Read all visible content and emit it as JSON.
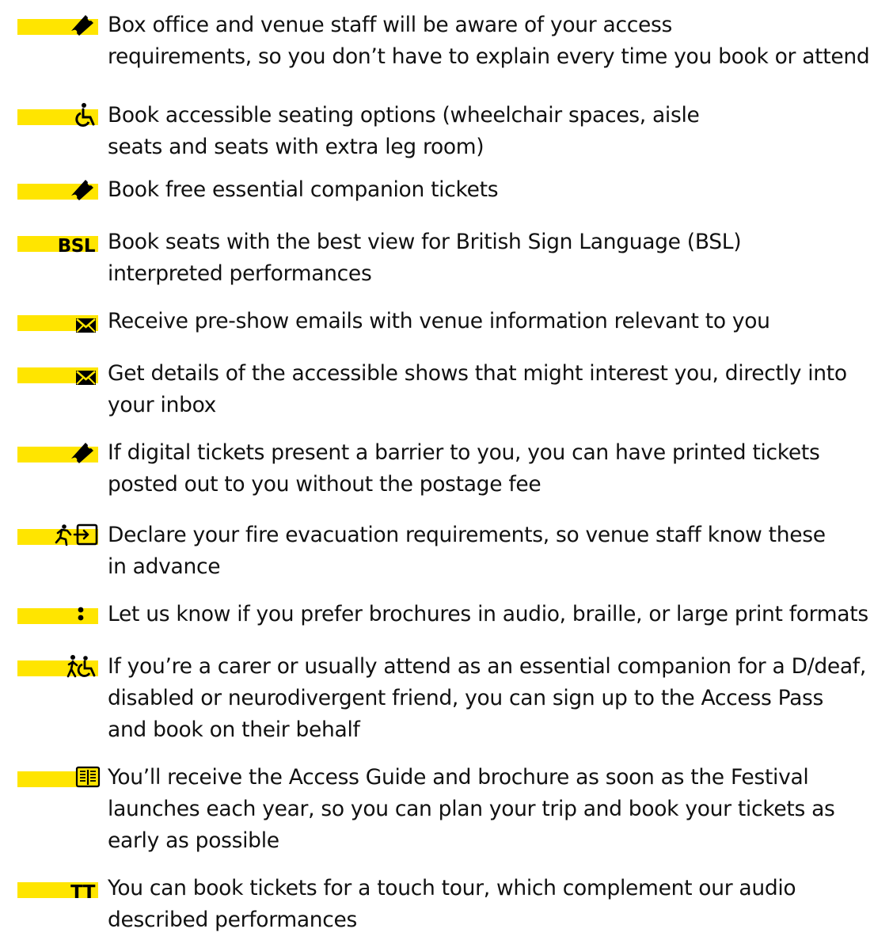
{
  "colors": {
    "badge": "#ffe500",
    "text": "#111111"
  },
  "items": [
    {
      "icon": "ticket-icon",
      "text": "Box office and venue staff will be aware of your access\nrequirements, so you don’t have to explain every time you book or attend"
    },
    {
      "icon": "wheelchair-icon",
      "text": "Book accessible seating options (wheelchair spaces, aisle\nseats and seats with extra leg room)"
    },
    {
      "icon": "ticket-icon",
      "text": "Book free essential companion tickets"
    },
    {
      "icon": "bsl-icon",
      "icon_text": "BSL",
      "text": "Book seats with the best view for British Sign Language (BSL)\ninterpreted performances"
    },
    {
      "icon": "envelope-icon",
      "text": "Receive pre-show emails with venue information relevant to you"
    },
    {
      "icon": "envelope-icon",
      "text": "Get details of the accessible shows that might interest you, directly into\nyour inbox"
    },
    {
      "icon": "ticket-icon",
      "text": "If digital tickets present a barrier to you, you can have printed tickets\nposted out to you without the postage fee"
    },
    {
      "icon": "fire-exit-icon",
      "text": "Declare your fire evacuation requirements, so venue staff know these\nin advance"
    },
    {
      "icon": "braille-icon",
      "text": "Let us know if you prefer brochures in audio, braille, or large print formats"
    },
    {
      "icon": "companion-wheelchair-icon",
      "text": "If you’re a carer or usually attend as an essential companion for a D/deaf,\ndisabled or neurodivergent friend, you can sign up to the Access Pass\nand book on their behalf"
    },
    {
      "icon": "open-book-icon",
      "text": "You’ll receive the Access Guide and brochure as soon as the Festival\nlaunches each year, so you can plan your trip and book your tickets as\nearly as possible"
    },
    {
      "icon": "touch-tour-icon",
      "icon_text": "TT",
      "text": "You can book tickets for a touch tour, which complement our audio\ndescribed performances"
    }
  ]
}
